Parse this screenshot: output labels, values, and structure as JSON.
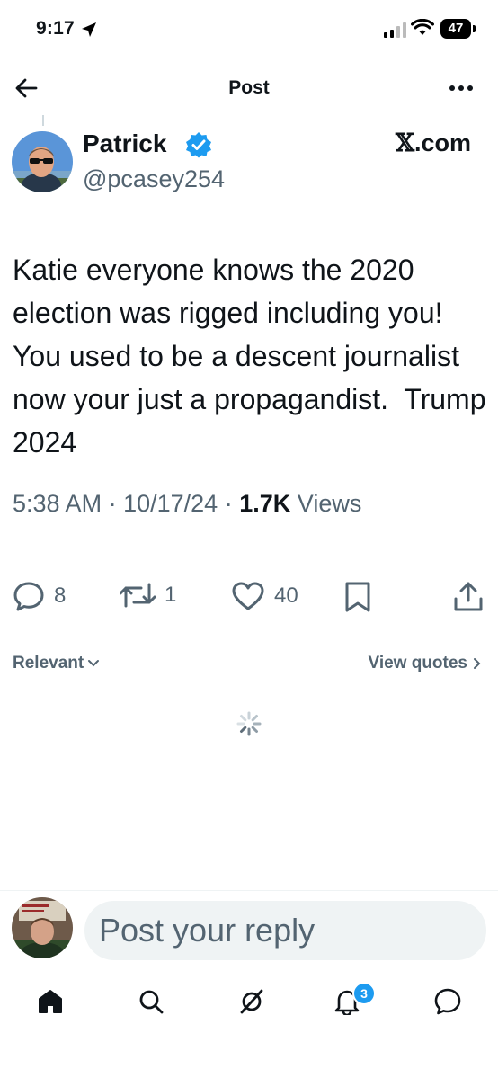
{
  "status_bar": {
    "time": "9:17",
    "battery": "47"
  },
  "header": {
    "title": "Post"
  },
  "post": {
    "author_name": "Patrick",
    "author_handle": "@pcasey254",
    "source": ".com",
    "text": "Katie everyone knows the 2020 election was rigged including you! You used to be a descent journalist now your just a propagandist.  Trump 2024",
    "time": "5:38 AM",
    "date": "10/17/24",
    "sep": "·",
    "views_count": "1.7K",
    "views_label": "Views"
  },
  "actions": {
    "replies": "8",
    "reposts": "1",
    "likes": "40"
  },
  "replies_bar": {
    "sort_label": "Relevant",
    "view_quotes_label": "View quotes"
  },
  "composer": {
    "placeholder": "Post your reply"
  },
  "bottom_nav": {
    "notification_count": "3"
  },
  "colors": {
    "accent": "#1d9bf0",
    "text": "#0f1419",
    "muted": "#536471"
  }
}
